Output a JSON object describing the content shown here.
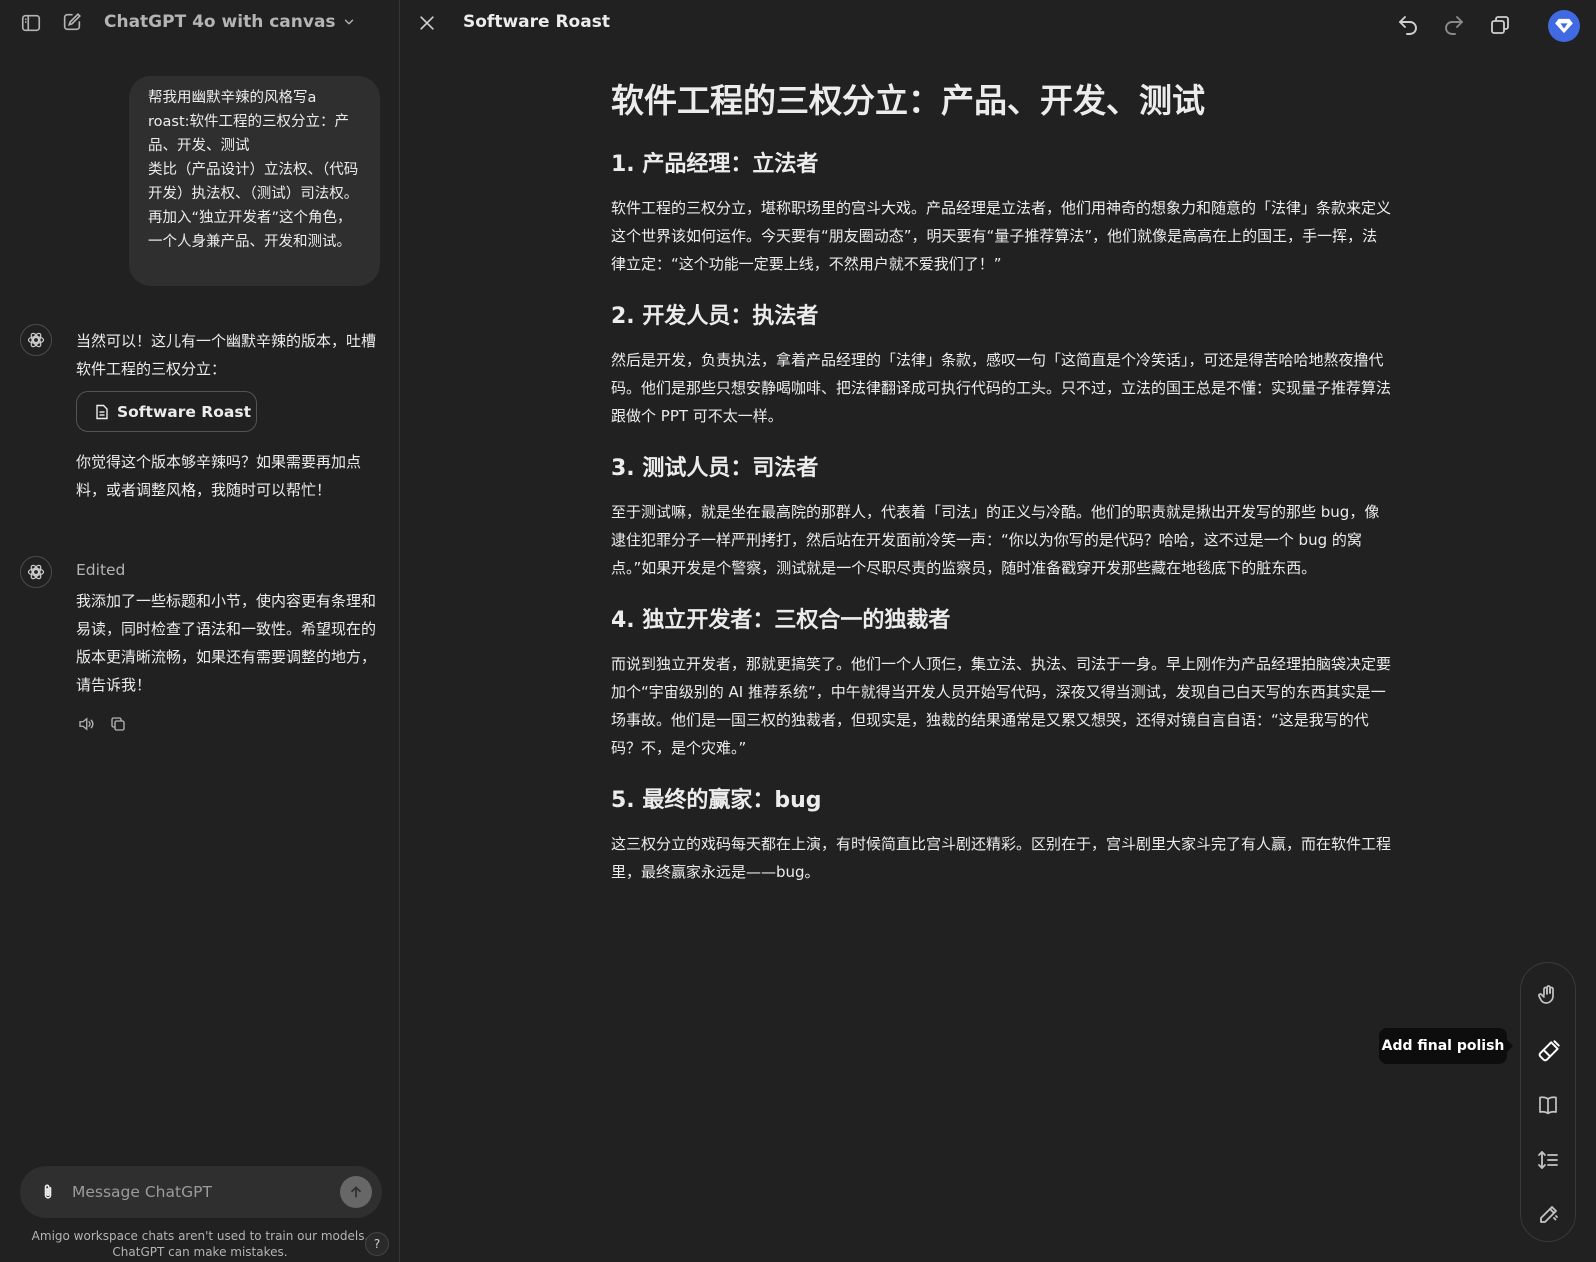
{
  "sidebar": {
    "model_name": "ChatGPT 4o with canvas",
    "user_message": "帮我用幽默辛辣的风格写a roast:软件工程的三权分立：产品、开发、测试\n类比（产品设计）立法权、（代码开发）执法权、（测试）司法权。再加入“独立开发者”这个角色，一个人身兼产品、开发和测试。",
    "reply_1_intro": "当然可以！这儿有一个幽默辛辣的版本，吐槽软件工程的三权分立：",
    "canvas_chip_label": "Software Roast",
    "reply_1_outro": "你觉得这个版本够辛辣吗？如果需要再加点料，或者调整风格，我随时可以帮忙！",
    "reply_2_status": "Edited",
    "reply_2_text": "我添加了一些标题和小节，使内容更有条理和易读，同时检查了语法和一致性。希望现在的版本更清晰流畅，如果还有需要调整的地方，请告诉我！",
    "composer_placeholder": "Message ChatGPT",
    "disclaimer": "Amigo workspace chats aren't used to train our models. ChatGPT can make mistakes.",
    "help_label": "?"
  },
  "canvas": {
    "title": "Software Roast",
    "doc_title": "软件工程的三权分立：产品、开发、测试",
    "sections": [
      {
        "heading": "1. 产品经理：立法者",
        "body": "软件工程的三权分立，堪称职场里的宫斗大戏。产品经理是立法者，他们用神奇的想象力和随意的「法律」条款来定义这个世界该如何运作。今天要有“朋友圈动态”，明天要有“量子推荐算法”，他们就像是高高在上的国王，手一挥，法律立定：“这个功能一定要上线，不然用户就不爱我们了！”"
      },
      {
        "heading": "2. 开发人员：执法者",
        "body": "然后是开发，负责执法，拿着产品经理的「法律」条款，感叹一句「这简直是个冷笑话」，可还是得苦哈哈地熬夜撸代码。他们是那些只想安静喝咖啡、把法律翻译成可执行代码的工头。只不过，立法的国王总是不懂：实现量子推荐算法跟做个 PPT 可不太一样。"
      },
      {
        "heading": "3. 测试人员：司法者",
        "body": "至于测试嘛，就是坐在最高院的那群人，代表着「司法」的正义与冷酷。他们的职责就是揪出开发写的那些 bug，像逮住犯罪分子一样严刑拷打，然后站在开发面前冷笑一声：“你以为你写的是代码？哈哈，这不过是一个 bug 的窝点。”如果开发是个警察，测试就是一个尽职尽责的监察员，随时准备戳穿开发那些藏在地毯底下的脏东西。"
      },
      {
        "heading": "4. 独立开发者：三权合一的独裁者",
        "body": "而说到独立开发者，那就更搞笑了。他们一个人顶仨，集立法、执法、司法于一身。早上刚作为产品经理拍脑袋决定要加个“宇宙级别的 AI 推荐系统”，中午就得当开发人员开始写代码，深夜又得当测试，发现自己白天写的东西其实是一场事故。他们是一国三权的独裁者，但现实是，独裁的结果通常是又累又想哭，还得对镜自言自语：“这是我写的代码？不，是个灾难。”"
      },
      {
        "heading": "5. 最终的赢家：bug",
        "body": "这三权分立的戏码每天都在上演，有时候简直比宫斗剧还精彩。区别在于，宫斗剧里大家斗完了有人赢，而在软件工程里，最终赢家永远是——bug。"
      }
    ],
    "tooltip": "Add final polish"
  },
  "icons": {
    "sidebar_toggle": "sidebar-toggle-icon",
    "new_chat": "new-chat-icon",
    "chevron": "chevron-down-icon",
    "close": "close-icon",
    "undo": "undo-icon",
    "redo": "redo-icon",
    "copy": "copy-icon",
    "profile": "diamond-icon",
    "emoji_hand": "hand-icon",
    "polish": "paintbrush-icon",
    "reading_level": "book-icon",
    "length": "length-icon",
    "edit": "pencil-icon",
    "attach": "paperclip-icon",
    "send": "arrow-up-icon",
    "read_aloud": "speaker-icon",
    "copy_message": "copy-icon"
  },
  "colors": {
    "background": "#212121",
    "bubble": "#2f2f2f",
    "accent": "#4169e1",
    "tooltip_bg": "#0d0d0d"
  }
}
